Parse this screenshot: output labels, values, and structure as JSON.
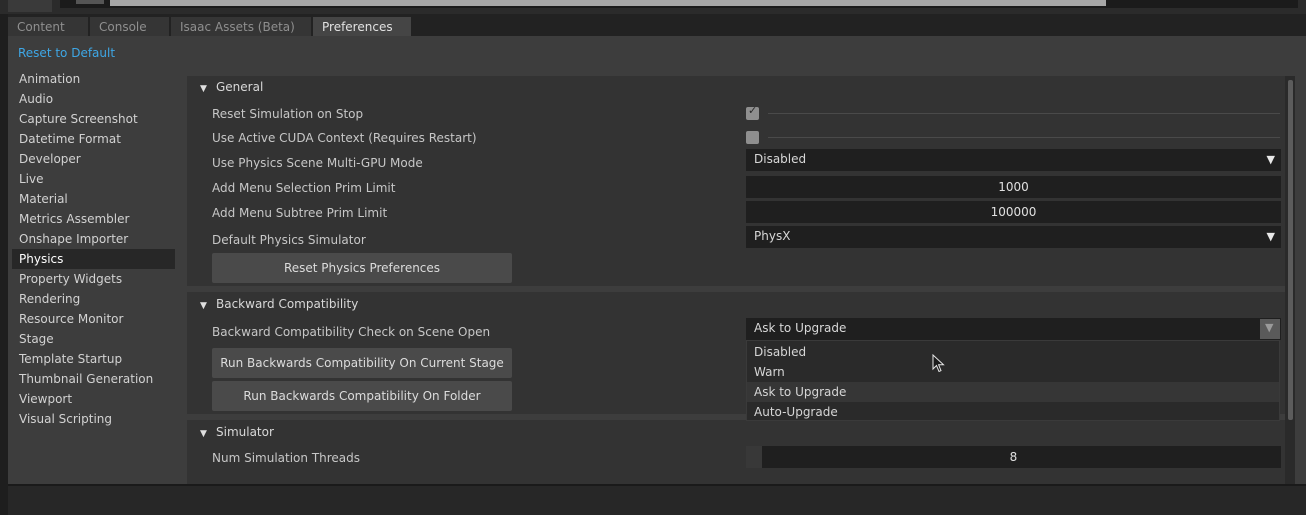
{
  "tabs": [
    "Content",
    "Console",
    "Isaac Assets (Beta)",
    "Preferences"
  ],
  "reset_to_default": "Reset to Default",
  "nav_items": [
    "Animation",
    "Audio",
    "Capture Screenshot",
    "Datetime Format",
    "Developer",
    "Live",
    "Material",
    "Metrics Assembler",
    "Onshape Importer",
    "Physics",
    "Property Widgets",
    "Rendering",
    "Resource Monitor",
    "Stage",
    "Template Startup",
    "Thumbnail Generation",
    "Viewport",
    "Visual Scripting"
  ],
  "general": {
    "title": "General",
    "reset_sim_label": "Reset Simulation on Stop",
    "reset_sim_checked": true,
    "cuda_label": "Use Active CUDA Context (Requires Restart)",
    "cuda_checked": false,
    "multigpu_label": "Use Physics Scene Multi-GPU Mode",
    "multigpu_value": "Disabled",
    "menu_sel_label": "Add Menu Selection Prim Limit",
    "menu_sel_value": "1000",
    "menu_subtree_label": "Add Menu Subtree Prim Limit",
    "menu_subtree_value": "100000",
    "default_sim_label": "Default Physics Simulator",
    "default_sim_value": "PhysX",
    "reset_prefs_button": "Reset Physics Preferences"
  },
  "backward": {
    "title": "Backward Compatibility",
    "check_label": "Backward Compatibility Check on Scene Open",
    "check_value": "Ask to Upgrade",
    "options": [
      "Disabled",
      "Warn",
      "Ask to Upgrade",
      "Auto-Upgrade"
    ],
    "highlighted_option": "Ask to Upgrade",
    "run_stage_button": "Run Backwards Compatibility On Current Stage",
    "run_folder_button": "Run Backwards Compatibility On Folder"
  },
  "simulator": {
    "title": "Simulator",
    "threads_label": "Num Simulation Threads",
    "threads_value": "8",
    "threads_fill": 0.03
  },
  "icons": {
    "collapse": "triangle-down-icon",
    "dropdown": "triangle-down-icon",
    "cursor": "mouse-pointer-icon"
  },
  "colors": {
    "accent": "#3ea7e6",
    "panel_bg": "#3d3d3d",
    "section_bg": "#333333",
    "field_bg": "#1f1f1f",
    "selected_nav_bg": "#272727"
  }
}
